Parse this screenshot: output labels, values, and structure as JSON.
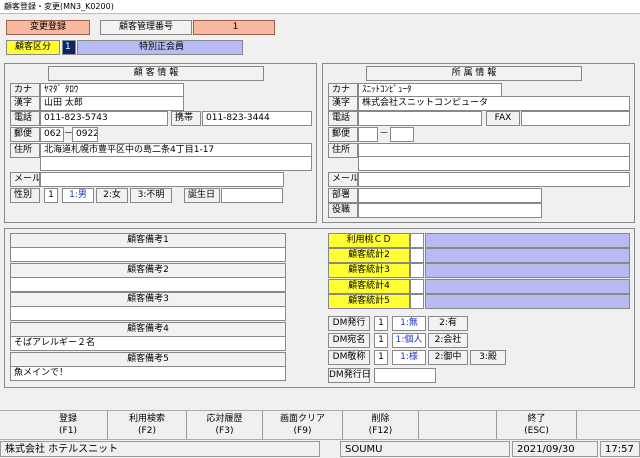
{
  "window": {
    "title": "顧客登録・変更(MN3_K0200)"
  },
  "header": {
    "mode": "変更登録",
    "customer_no_label": "顧客管理番号",
    "customer_no": "1",
    "category_label": "顧客区分",
    "category_code": "1",
    "category_name": "特別正会員"
  },
  "customer": {
    "title": "顧 客 情 報",
    "kana_label": "カナ",
    "kana": "ﾔﾏﾀﾞ ﾀﾛｳ",
    "kanji_label": "漢字",
    "kanji": "山田 太郎",
    "phone_label": "電話",
    "phone": "011-823-5743",
    "mobile_label": "携帯",
    "mobile": "011-823-3444",
    "zip_label": "郵便",
    "zip1": "062",
    "zip_sep": "－",
    "zip2": "0922",
    "address_label": "住所",
    "address1": "北海道札幌市豊平区中の島二条4丁目1-17",
    "address2": "",
    "mail_label": "メール",
    "mail": "",
    "gender_label": "性別",
    "gender_code": "1",
    "gender_opt1": "1:男",
    "gender_opt2": "2:女",
    "gender_opt3": "3:不明",
    "birthday_label": "誕生日",
    "birthday": ""
  },
  "affiliation": {
    "title": "所 属 情 報",
    "kana_label": "カナ",
    "kana": "ｽﾆｯﾄｺﾝﾋﾟｭｰﾀ",
    "kanji_label": "漢字",
    "kanji": "株式会社スニットコンピュータ",
    "phone_label": "電話",
    "phone": "",
    "fax_label": "FAX",
    "fax": "",
    "zip_label": "郵便",
    "zip1": "",
    "zip_sep": "－",
    "zip2": "",
    "address_label": "住所",
    "address1": "",
    "address2": "",
    "mail_label": "メール",
    "mail": "",
    "dept_label": "部署",
    "dept": "",
    "position_label": "役職",
    "position": ""
  },
  "remarks": {
    "r1_label": "顧客備考1",
    "r1": "",
    "r2_label": "顧客備考2",
    "r2": "",
    "r3_label": "顧客備考3",
    "r3": "",
    "r4_label": "顧客備考4",
    "r4": "そばアレルギー２名",
    "r5_label": "顧客備考5",
    "r5": "魚メインで！"
  },
  "stats": {
    "usage_label": "利用桃ＣＤ",
    "s2_label": "顧客統計2",
    "s3_label": "顧客統計3",
    "s4_label": "顧客統計4",
    "s5_label": "顧客統計5"
  },
  "dm": {
    "issue_label": "DM発行",
    "issue_code": "1",
    "issue_opt1": "1:無",
    "issue_opt2": "2:有",
    "dest_label": "DM宛名",
    "dest_code": "1",
    "dest_opt1": "1:個人",
    "dest_opt2": "2:会社",
    "honor_label": "DM敬称",
    "honor_code": "1",
    "honor_opt1": "1:様",
    "honor_opt2": "2:御中",
    "honor_opt3": "3:殿",
    "date_label": "DM発行日",
    "date": ""
  },
  "fkeys": {
    "f1": "登録",
    "f1k": "(F1)",
    "f2": "利用検索",
    "f2k": "(F2)",
    "f3": "応対履歴",
    "f3k": "(F3)",
    "f9": "画面クリア",
    "f9k": "(F9)",
    "f12": "削除",
    "f12k": "(F12)",
    "esc": "終了",
    "esck": "(ESC)"
  },
  "status": {
    "company": "株式会社 ホテルスニット",
    "user": "SOUMU",
    "date": "2021/09/30",
    "time": "17:57"
  }
}
